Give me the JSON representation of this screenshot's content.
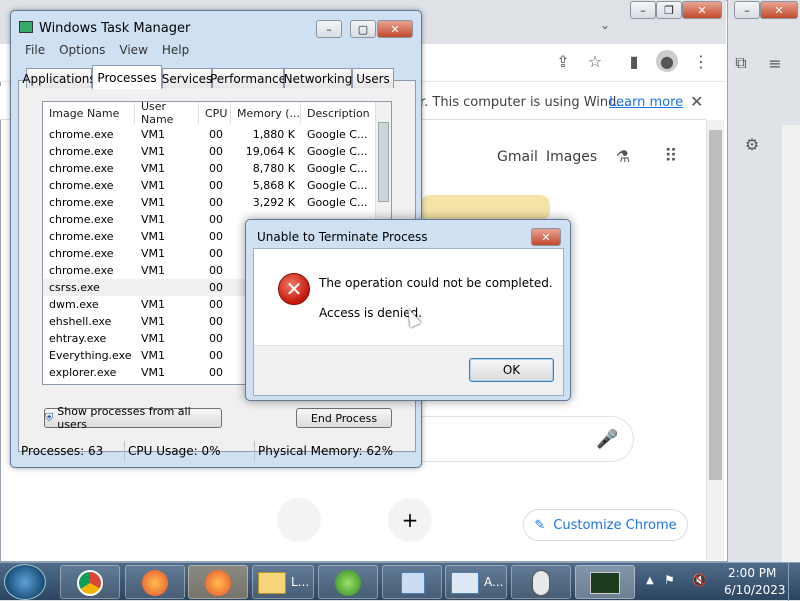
{
  "chrome": {
    "infobar_text": "r. This computer is using Wind...",
    "infobar_link": "Learn more",
    "links": {
      "gmail": "Gmail",
      "images": "Images"
    },
    "customize_label": "Customize Chrome",
    "icons": [
      "share-icon",
      "star-icon",
      "sidepanel-icon",
      "profile-icon",
      "menu-icon",
      "extensions-icon",
      "settings-icon",
      "labs-icon",
      "apps-icon",
      "mic-icon",
      "plus-icon"
    ]
  },
  "task_manager": {
    "title": "Windows Task Manager",
    "menu": [
      "File",
      "Options",
      "View",
      "Help"
    ],
    "tabs": [
      "Applications",
      "Processes",
      "Services",
      "Performance",
      "Networking",
      "Users"
    ],
    "active_tab": "Processes",
    "columns": [
      "Image Name",
      "User Name",
      "CPU",
      "Memory (...",
      "Description"
    ],
    "rows": [
      {
        "name": "chrome.exe",
        "user": "VM1",
        "cpu": "00",
        "mem": "1,880 K",
        "desc": "Google C..."
      },
      {
        "name": "chrome.exe",
        "user": "VM1",
        "cpu": "00",
        "mem": "19,064 K",
        "desc": "Google C..."
      },
      {
        "name": "chrome.exe",
        "user": "VM1",
        "cpu": "00",
        "mem": "8,780 K",
        "desc": "Google C..."
      },
      {
        "name": "chrome.exe",
        "user": "VM1",
        "cpu": "00",
        "mem": "5,868 K",
        "desc": "Google C..."
      },
      {
        "name": "chrome.exe",
        "user": "VM1",
        "cpu": "00",
        "mem": "3,292 K",
        "desc": "Google C..."
      },
      {
        "name": "chrome.exe",
        "user": "VM1",
        "cpu": "00",
        "mem": "",
        "desc": ""
      },
      {
        "name": "chrome.exe",
        "user": "VM1",
        "cpu": "00",
        "mem": "",
        "desc": ""
      },
      {
        "name": "chrome.exe",
        "user": "VM1",
        "cpu": "00",
        "mem": "",
        "desc": ""
      },
      {
        "name": "chrome.exe",
        "user": "VM1",
        "cpu": "00",
        "mem": "",
        "desc": ""
      },
      {
        "name": "csrss.exe",
        "user": "",
        "cpu": "00",
        "mem": "",
        "desc": ""
      },
      {
        "name": "dwm.exe",
        "user": "VM1",
        "cpu": "00",
        "mem": "",
        "desc": ""
      },
      {
        "name": "ehshell.exe",
        "user": "VM1",
        "cpu": "00",
        "mem": "",
        "desc": ""
      },
      {
        "name": "ehtray.exe",
        "user": "VM1",
        "cpu": "00",
        "mem": "",
        "desc": ""
      },
      {
        "name": "Everything.exe",
        "user": "VM1",
        "cpu": "00",
        "mem": "",
        "desc": ""
      },
      {
        "name": "explorer.exe",
        "user": "VM1",
        "cpu": "00",
        "mem": "",
        "desc": ""
      }
    ],
    "show_all_label": "Show processes from all users",
    "end_process_label": "End Process",
    "status": {
      "processes": "Processes: 63",
      "cpu": "CPU Usage: 0%",
      "memory": "Physical Memory: 62%"
    }
  },
  "dialog": {
    "title": "Unable to Terminate Process",
    "line1": "The operation could not be completed.",
    "line2": "Access is denied.",
    "ok_label": "OK"
  },
  "taskbar": {
    "items": [
      "chrome",
      "firefox",
      "firefox",
      "explorer",
      "media-center",
      "control-panel",
      "network",
      "mouse",
      "task-manager"
    ],
    "explorer_label": "L...",
    "app_label": "A...",
    "time": "2:00 PM",
    "date": "6/10/2023"
  }
}
